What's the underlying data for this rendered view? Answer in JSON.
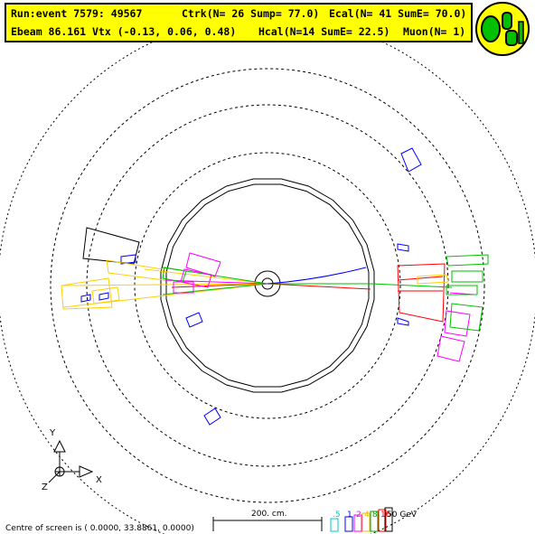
{
  "header": {
    "line1_run": "Run:event 7579: 49567",
    "line1_ctrk": "Ctrk(N= 26 Sump= 77.0)",
    "line1_ecal": "Ecal(N= 41 SumE= 70.0)",
    "line2_ebeam": "Ebeam 86.161 Vtx (-0.13, 0.06, 0.48)",
    "line2_hcal": "Hcal(N=14 SumE= 22.5)",
    "line2_muon": "Muon(N= 1)"
  },
  "logo": {
    "text": "OPAL",
    "name": "opal-logo"
  },
  "axes": {
    "y": "Y",
    "x": "X",
    "z": "Z"
  },
  "footer": {
    "centre": "Centre of screen is (   0.0000,  33.8861,   0.0000)",
    "scale_label": "200. cm.",
    "energy_scale": [
      {
        "label": ".5",
        "color": "#00c8c8"
      },
      {
        "label": "1",
        "color": "#0000ff"
      },
      {
        "label": "2",
        "color": "#ff00ff"
      },
      {
        "label": "4",
        "color": "#e0c000"
      },
      {
        "label": "8",
        "color": "#00a000"
      },
      {
        "label": "16",
        "color": "#ff0000"
      },
      {
        "label": "50 GeV",
        "color": "#000000"
      }
    ]
  },
  "colors": {
    "banner_bg": "#ffff00",
    "logo_bg": "#ffff00",
    "logo_fg": "#00c000",
    "track": "#ff0000",
    "ecal": "#ffff00",
    "hcal": "#00c000",
    "muon": "#0000ff",
    "cluster": "#ff00ff"
  }
}
